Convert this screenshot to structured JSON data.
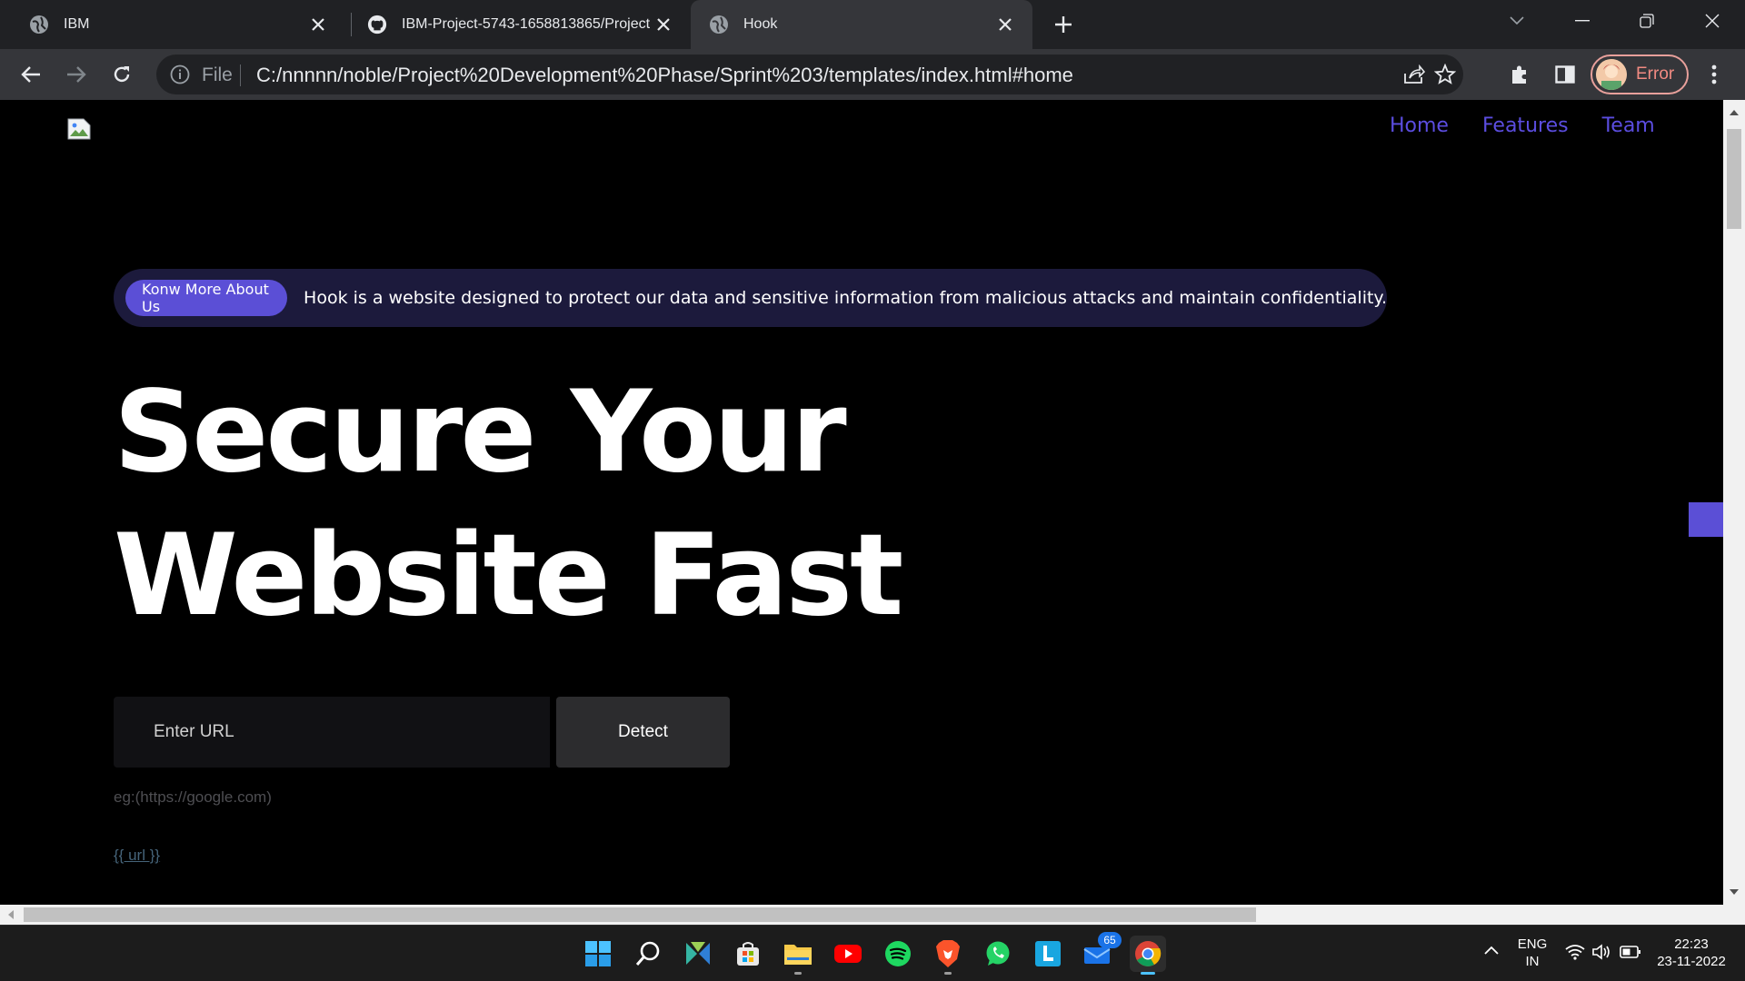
{
  "browser": {
    "tabs": [
      {
        "title": "IBM",
        "favicon": "globe-icon"
      },
      {
        "title": "IBM-Project-5743-1658813865/Project",
        "favicon": "github-icon"
      },
      {
        "title": "Hook",
        "favicon": "globe-icon"
      }
    ],
    "active_tab": 2,
    "omnibox": {
      "scheme_label": "File",
      "url": "C:/nnnnn/noble/Project%20Development%20Phase/Sprint%203/templates/index.html#home"
    },
    "profile_label": "Error"
  },
  "page": {
    "nav": [
      "Home",
      "Features",
      "Team"
    ],
    "banner": {
      "chip_label": "Konw More About Us",
      "description": "Hook is a website designed to protect our data and sensitive information from malicious attacks and maintain confidentiality."
    },
    "hero": {
      "line1": "Secure Your",
      "line2": "Website Fast"
    },
    "form": {
      "placeholder": "Enter URL",
      "button": "Detect",
      "hint": "eg:(https://google.com)",
      "template_output": "{{ url }}"
    },
    "colors": {
      "accent": "#5b4fd6",
      "nav_link": "#5b4de0",
      "banner_bg": "#1c1a3c"
    }
  },
  "taskbar": {
    "apps": [
      "start-icon",
      "search-icon",
      "widgets-icon",
      "store-icon",
      "file-explorer-icon",
      "youtube-icon",
      "spotify-icon",
      "brave-icon",
      "whatsapp-icon",
      "l-app-icon",
      "mail-icon",
      "chrome-icon"
    ],
    "mail_badge": "65",
    "language": {
      "line1": "ENG",
      "line2": "IN"
    },
    "time": "22:23",
    "date": "23-11-2022"
  }
}
